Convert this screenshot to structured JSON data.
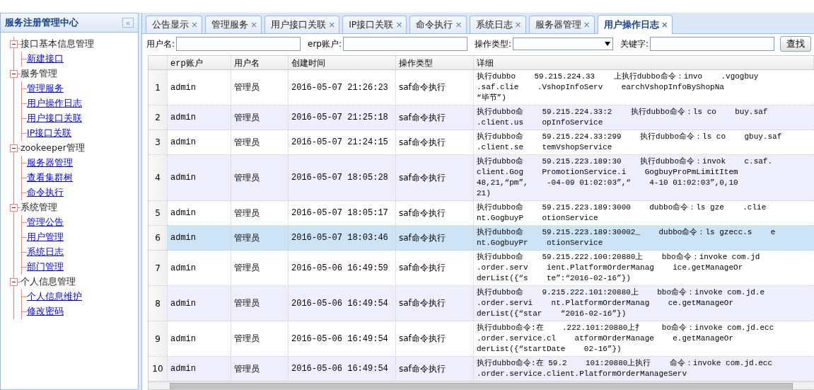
{
  "sidebar": {
    "title": "服务注册管理中心",
    "collapse_icon": "«",
    "groups": [
      {
        "label": "接口基本信息管理",
        "expanded": true,
        "children": [
          {
            "label": "新建接口"
          }
        ]
      },
      {
        "label": "服务管理",
        "expanded": true,
        "children": [
          {
            "label": "管理服务"
          },
          {
            "label": "用户操作日志"
          },
          {
            "label": "用户接口关联"
          },
          {
            "label": "IP接口关联"
          }
        ]
      },
      {
        "label": "zookeeper管理",
        "expanded": true,
        "children": [
          {
            "label": "服务器管理"
          },
          {
            "label": "查看集群树"
          },
          {
            "label": "命令执行"
          }
        ]
      },
      {
        "label": "系统管理",
        "expanded": true,
        "children": [
          {
            "label": "管理公告"
          },
          {
            "label": "用户管理"
          },
          {
            "label": "系统日志"
          },
          {
            "label": "部门管理"
          }
        ]
      },
      {
        "label": "个人信息管理",
        "expanded": true,
        "children": [
          {
            "label": "个人信息维护"
          },
          {
            "label": "修改密码"
          }
        ]
      }
    ]
  },
  "tabs": [
    {
      "label": "公告显示",
      "close": "×",
      "selected": false
    },
    {
      "label": "管理服务",
      "close": "×",
      "selected": false
    },
    {
      "label": "用户接口关联",
      "close": "×",
      "selected": false
    },
    {
      "label": "IP接口关联",
      "close": "×",
      "selected": false
    },
    {
      "label": "命令执行",
      "close": "×",
      "selected": false
    },
    {
      "label": "系统日志",
      "close": "×",
      "selected": false
    },
    {
      "label": "服务器管理",
      "close": "×",
      "selected": false
    },
    {
      "label": "用户操作日志",
      "close": "×",
      "selected": true
    }
  ],
  "filters": [
    {
      "kind": "input",
      "label": "用户名:"
    },
    {
      "kind": "input",
      "label": "erp账户:"
    },
    {
      "kind": "select",
      "label": "操作类型:"
    },
    {
      "kind": "input",
      "label": "关键字:"
    }
  ],
  "search_button": "查找",
  "table": {
    "columns": [
      "erp账户",
      "用户名",
      "创建时间",
      "操作类型",
      "详细"
    ],
    "rows": [
      {
        "index": "1",
        "erp": "admin",
        "user": "管理员",
        "time": "2016-05-07 21:26:23",
        "type": "saf命令执行",
        "selected": false,
        "detail": "执行dubbo    59.215.224.33    上执行dubbo命令：invo    .vgogbuy\n.saf.clie    .VshopInfoServ    earchVshopInfoByShopNa\n“毕节”)"
      },
      {
        "index": "2",
        "erp": "admin",
        "user": "管理员",
        "time": "2016-05-07 21:25:18",
        "type": "saf命令执行",
        "selected": false,
        "detail": "执行dubbo命    59.215.224.33:2    执行dubbo命令：ls co    buy.saf\n.client.us    opInfoService"
      },
      {
        "index": "3",
        "erp": "admin",
        "user": "管理员",
        "time": "2016-05-07 21:24:15",
        "type": "saf命令执行",
        "selected": false,
        "detail": "执行dubbo命    59.215.224.33:299    执行dubbo命令：ls co    gbuy.saf\n.client.se    temVshopService"
      },
      {
        "index": "4",
        "erp": "admin",
        "user": "管理员",
        "time": "2016-05-07 18:05:28",
        "type": "saf命令执行",
        "selected": false,
        "detail": "执行dubbo命    59.215.223.189:30    执行dubbo命令：invok    c.saf.\nclient.Gog    PromotionService.i    GogbuyProPmLimitItem\n48,21,“pm”,    -04-09 01:02:03”,“    4-10 01:02:03”,0,10\n21)"
      },
      {
        "index": "5",
        "erp": "admin",
        "user": "管理员",
        "time": "2016-05-07 18:05:17",
        "type": "saf命令执行",
        "selected": false,
        "detail": "执行dubbo命    59.215.223.189:3000    dubbo命令：ls gze    .clie\nnt.GogbuyP    otionService"
      },
      {
        "index": "6",
        "erp": "admin",
        "user": "管理员",
        "time": "2016-05-07 18:03:46",
        "type": "saf命令执行",
        "selected": true,
        "detail": "执行dubbo命    59.215.223.189:30002_    dubbo命令：ls gzecc.s    e\nnt.GogbuyPr    otionService"
      },
      {
        "index": "7",
        "erp": "admin",
        "user": "管理员",
        "time": "2016-05-06 16:49:59",
        "type": "saf命令执行",
        "selected": false,
        "detail": "执行dubbo命    59.215.222.100:20880上    bbo命令：invoke com.jd\n.order.serv    ient.PlatformOrderManag    ice.getManageOr\nderList({“s    te”:“2016-02-16”})"
      },
      {
        "index": "8",
        "erp": "admin",
        "user": "管理员",
        "time": "2016-05-06 16:49:54",
        "type": "saf命令执行",
        "selected": false,
        "detail": "执行dubbo命    9.215.222.101:20880上    bbo命令：invoke com.jd.e\n.order.servi    nt.PlatformOrderManag    ce.getManageOr\nderList({“star    “2016-02-16”})"
      },
      {
        "index": "9",
        "erp": "admin",
        "user": "管理员",
        "time": "2016-05-06 16:49:54",
        "type": "saf命令执行",
        "selected": false,
        "detail": "执行dubbo命令:在    .222.101:20880上扌    bo命令：invoke com.jd.ecc\n.order.service.cl    atformOrderManage    e.getManageOr\nderList({“startDate    02-16”})"
      },
      {
        "index": "10",
        "erp": "admin",
        "user": "管理员",
        "time": "2016-05-06 16:49:54",
        "type": "saf命令执行",
        "selected": false,
        "detail": "执行dubbo命令:在 59.2    101:20880上执行    命令：invoke com.jd.ecc\n.order.service.client.PlatformOrderManageServ"
      }
    ]
  }
}
